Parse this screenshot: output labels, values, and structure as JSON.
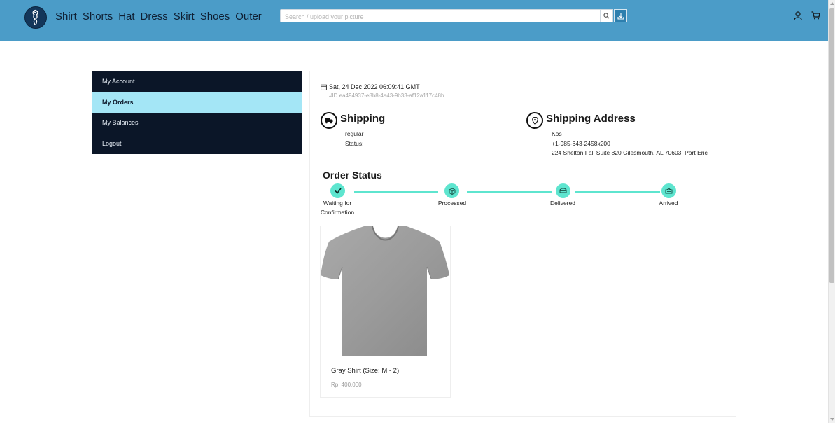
{
  "header": {
    "nav": [
      "Shirt",
      "Shorts",
      "Hat",
      "Dress",
      "Skirt",
      "Shoes",
      "Outer"
    ],
    "search_placeholder": "Search / upload your picture"
  },
  "sidebar": {
    "items": [
      {
        "label": "My Account"
      },
      {
        "label": "My Orders"
      },
      {
        "label": "My Balances"
      },
      {
        "label": "Logout"
      }
    ]
  },
  "order": {
    "date": "Sat, 24 Dec 2022 06:09:41 GMT",
    "id": "#ID ea494937-e8b8-4a43-9b33-af12a117c48b",
    "shipping": {
      "title": "Shipping",
      "method": "regular",
      "status_label": "Status:"
    },
    "address": {
      "title": "Shipping Address",
      "name": "Kos",
      "phone": "+1-985-643-2458x200",
      "line": "224 Shelton Fall Suite 820 Gilesmouth, AL 70603, Port Eric"
    },
    "status": {
      "title": "Order Status",
      "steps": [
        {
          "label_line1": "Waiting for",
          "label_line2": "Confirmation",
          "icon": "check-icon"
        },
        {
          "label_line1": "Processed",
          "label_line2": "",
          "icon": "box-icon"
        },
        {
          "label_line1": "Delivered",
          "label_line2": "",
          "icon": "truck-icon"
        },
        {
          "label_line1": "Arrived",
          "label_line2": "",
          "icon": "package-arrived-icon"
        }
      ]
    },
    "product": {
      "name": "Gray Shirt (Size: M - 2)",
      "price": "Rp. 400,000"
    }
  },
  "colors": {
    "header": "#4b9cc8",
    "sidebar": "#0b1628",
    "sidebar_active": "#a4e6f6",
    "step": "#5ee5cf"
  }
}
